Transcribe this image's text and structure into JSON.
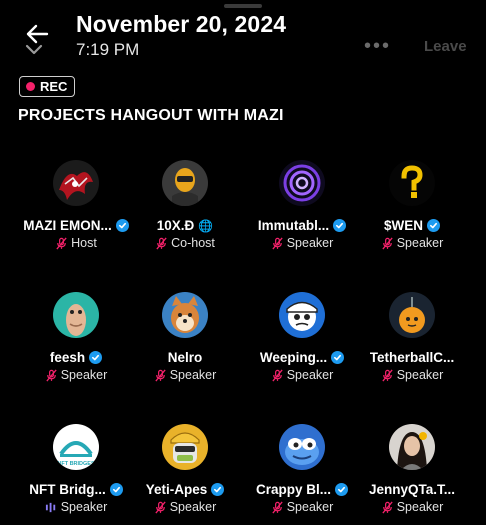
{
  "header": {
    "date": "November 20, 2024",
    "time": "7:19 PM",
    "more_icon": "•••",
    "leave_label": "Leave"
  },
  "recording": {
    "label": "REC",
    "color": "#f4216a"
  },
  "space": {
    "title": "PROJECTS HANGOUT WITH MAZI"
  },
  "participants": [
    {
      "name": "MAZI EMON...",
      "role": "Host",
      "verified": true,
      "badge": "verified",
      "mic": "muted",
      "avatar": "red-dragon"
    },
    {
      "name": "10X.Đ",
      "role": "Co-host",
      "verified": false,
      "badge": "globe",
      "mic": "muted",
      "avatar": "gold-helmet"
    },
    {
      "name": "Immutabl...",
      "role": "Speaker",
      "verified": true,
      "badge": "verified",
      "mic": "muted",
      "avatar": "purple-vortex"
    },
    {
      "name": "$WEN",
      "role": "Speaker",
      "verified": true,
      "badge": "verified",
      "mic": "muted",
      "avatar": "question-mark"
    },
    {
      "name": "feesh",
      "role": "Speaker",
      "verified": true,
      "badge": "verified",
      "mic": "muted",
      "avatar": "fish"
    },
    {
      "name": "Nelro",
      "role": "Speaker",
      "verified": false,
      "badge": "none",
      "mic": "muted",
      "avatar": "shiba"
    },
    {
      "name": "Weeping...",
      "role": "Speaker",
      "verified": true,
      "badge": "verified",
      "mic": "muted",
      "avatar": "blue-cartoon"
    },
    {
      "name": "TetherballC...",
      "role": "Speaker",
      "verified": false,
      "badge": "none",
      "mic": "muted",
      "avatar": "orange-ball"
    },
    {
      "name": "NFT Bridg...",
      "role": "Speaker",
      "verified": true,
      "badge": "verified",
      "mic": "speaking",
      "avatar": "nft-bridges"
    },
    {
      "name": "Yeti-Apes",
      "role": "Speaker",
      "verified": true,
      "badge": "verified",
      "mic": "muted",
      "avatar": "yeti"
    },
    {
      "name": "Crappy Bl...",
      "role": "Speaker",
      "verified": true,
      "badge": "verified",
      "mic": "muted",
      "avatar": "pepe"
    },
    {
      "name": "JennyQTa.T...",
      "role": "Speaker",
      "verified": false,
      "badge": "none",
      "mic": "muted",
      "avatar": "portrait"
    }
  ],
  "colors": {
    "background": "#000000",
    "verified": "#1d9bf0",
    "muted_mic": "#f4216a",
    "speaking": "#8a7cf6"
  }
}
